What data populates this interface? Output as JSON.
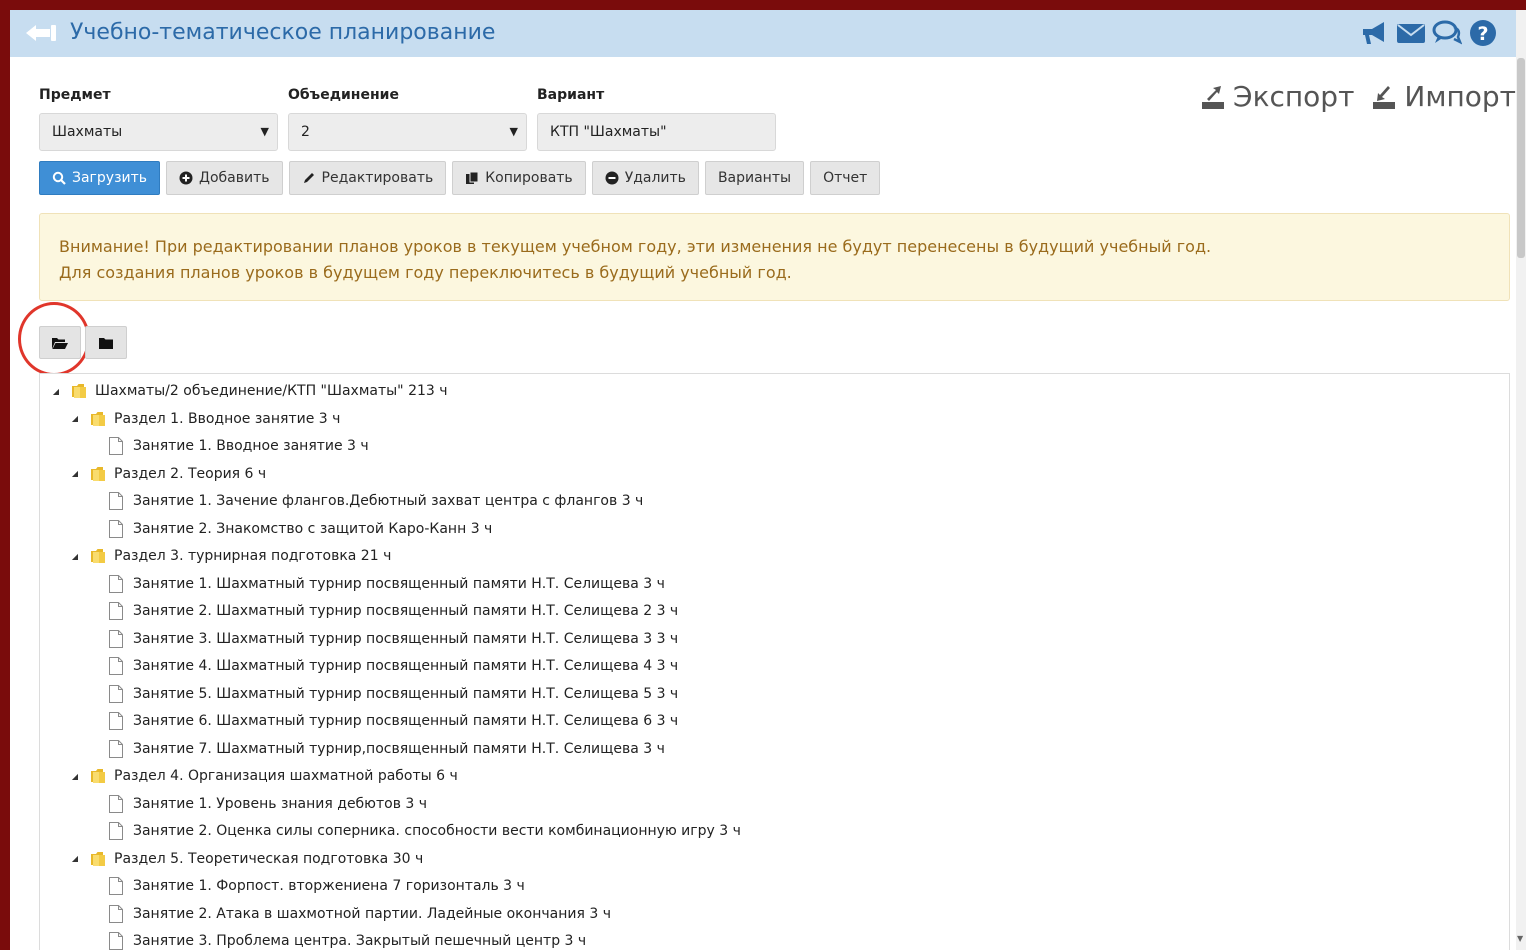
{
  "title": "Учебно-тематическое планирование",
  "filters": {
    "subject_label": "Предмет",
    "subject_value": "Шахматы",
    "group_label": "Объединение",
    "group_value": "2",
    "variant_label": "Вариант",
    "variant_value": "КТП \"Шахматы\""
  },
  "links": {
    "export": "Экспорт",
    "import": "Импорт"
  },
  "toolbar": {
    "load": "Загрузить",
    "add": "Добавить",
    "edit": "Редактировать",
    "copy": "Копировать",
    "delete": "Удалить",
    "variants": "Варианты",
    "report": "Отчет"
  },
  "alert": {
    "line1": "Внимание! При редактировании планов уроков в текущем учебном году, эти изменения не будут перенесены в будущий учебный год.",
    "line2": "Для создания планов уроков в будущем году переключитесь в будущий учебный год."
  },
  "colors": {
    "accent": "#3f8fd6",
    "title": "#2c6aa8",
    "header": "#c7ddf0",
    "alert_text": "#9a6b1c",
    "highlight": "#e0362b"
  },
  "tree": [
    {
      "level": 0,
      "type": "folder",
      "label": "Шахматы/2 объединение/КТП \"Шахматы\" 213 ч"
    },
    {
      "level": 1,
      "type": "folder",
      "label": "Раздел 1. Вводное занятие 3 ч"
    },
    {
      "level": 2,
      "type": "file",
      "label": "Занятие 1. Вводное занятие 3 ч"
    },
    {
      "level": 1,
      "type": "folder",
      "label": "Раздел 2. Теория 6 ч"
    },
    {
      "level": 2,
      "type": "file",
      "label": "Занятие 1. Зачение флангов.Дебютный захват центра с флангов 3 ч"
    },
    {
      "level": 2,
      "type": "file",
      "label": "Занятие 2. Знакомство с защитой Каро-Канн 3 ч"
    },
    {
      "level": 1,
      "type": "folder",
      "label": "Раздел 3. турнирная подготовка 21 ч"
    },
    {
      "level": 2,
      "type": "file",
      "label": "Занятие 1. Шахматный турнир посвященный памяти Н.Т. Селищева 3 ч"
    },
    {
      "level": 2,
      "type": "file",
      "label": "Занятие 2. Шахматный турнир посвященный памяти Н.Т. Селищева 2 3 ч"
    },
    {
      "level": 2,
      "type": "file",
      "label": "Занятие 3. Шахматный турнир посвященный памяти Н.Т. Селищева 3 3 ч"
    },
    {
      "level": 2,
      "type": "file",
      "label": "Занятие 4. Шахматный турнир посвященный памяти Н.Т. Селищева 4 3 ч"
    },
    {
      "level": 2,
      "type": "file",
      "label": "Занятие 5. Шахматный турнир посвященный памяти Н.Т. Селищева 5 3 ч"
    },
    {
      "level": 2,
      "type": "file",
      "label": "Занятие 6. Шахматный турнир посвященный памяти Н.Т. Селищева 6 3 ч"
    },
    {
      "level": 2,
      "type": "file",
      "label": "Занятие 7. Шахматный турнир,посвященный памяти Н.Т. Селищева 3 ч"
    },
    {
      "level": 1,
      "type": "folder",
      "label": "Раздел 4. Организация шахматной работы 6 ч"
    },
    {
      "level": 2,
      "type": "file",
      "label": "Занятие 1. Уровень знания дебютов 3 ч"
    },
    {
      "level": 2,
      "type": "file",
      "label": "Занятие 2. Оценка силы соперника. способности вести комбинационную игру 3 ч"
    },
    {
      "level": 1,
      "type": "folder",
      "label": "Раздел 5. Теоретическая подготовка 30 ч"
    },
    {
      "level": 2,
      "type": "file",
      "label": "Занятие 1. Форпост. вторжениена 7 горизонталь 3 ч"
    },
    {
      "level": 2,
      "type": "file",
      "label": "Занятие 2. Атака в шахмотной партии. Ладейные окончания 3 ч"
    },
    {
      "level": 2,
      "type": "file",
      "label": "Занятие 3. Проблема центра. Закрытый пешечный центр 3 ч"
    }
  ]
}
